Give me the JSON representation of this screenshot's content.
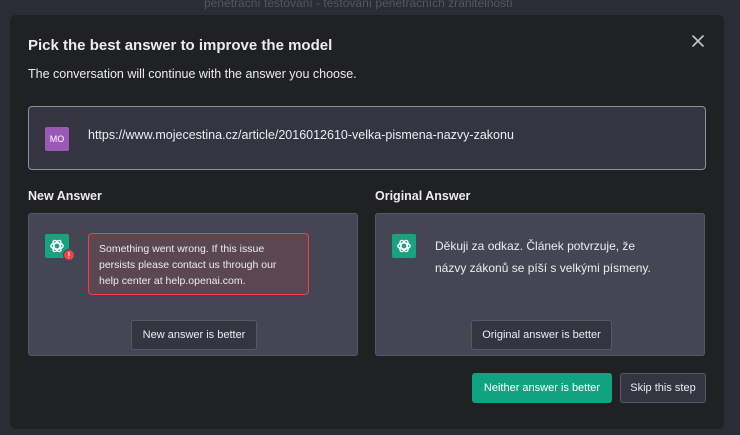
{
  "background": {
    "text": "penetrační testování - testování penetračních zranitelností"
  },
  "modal": {
    "title": "Pick the best answer to improve the model",
    "subtitle": "The conversation will continue with the answer you choose."
  },
  "prompt": {
    "avatar": "MO",
    "text": "https://www.mojecestina.cz/article/2016012610-velka-pismena-nazvy-zakonu"
  },
  "new_answer": {
    "label": "New Answer",
    "error_badge": "!",
    "error_text": "Something went wrong. If this issue persists please contact us through our help center at help.openai.com.",
    "button": "New answer is better"
  },
  "original_answer": {
    "label": "Original Answer",
    "text": "Děkuji za odkaz. Článek potvrzuje, že názvy zákonů se píší s velkými písmeny.",
    "button": "Original answer is better"
  },
  "footer": {
    "neither_button": "Neither answer is better",
    "skip_button": "Skip this step"
  },
  "colors": {
    "accent": "#10a37f",
    "error": "#ef4146",
    "avatar": "#9b59b6"
  },
  "icons": {
    "close": "close-icon",
    "assistant": "openai-logo-icon"
  }
}
